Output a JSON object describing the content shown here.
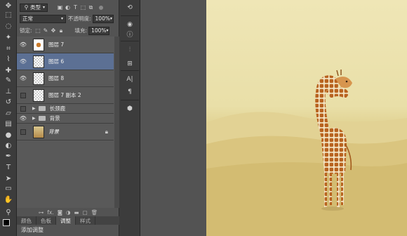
{
  "toolbar": {
    "tools": [
      {
        "icon": "move-icon",
        "glyph": "✥"
      },
      {
        "icon": "marquee-icon",
        "glyph": "⬚"
      },
      {
        "icon": "lasso-icon",
        "glyph": "◌"
      },
      {
        "icon": "magic-wand-icon",
        "glyph": "✦"
      },
      {
        "icon": "crop-icon",
        "glyph": "⌗"
      },
      {
        "icon": "eyedropper-icon",
        "glyph": "⌇"
      },
      {
        "icon": "healing-brush-icon",
        "glyph": "✚"
      },
      {
        "icon": "brush-icon",
        "glyph": "✎"
      },
      {
        "icon": "clone-stamp-icon",
        "glyph": "⊥"
      },
      {
        "icon": "history-brush-icon",
        "glyph": "↺"
      },
      {
        "icon": "eraser-icon",
        "glyph": "▱"
      },
      {
        "icon": "gradient-icon",
        "glyph": "▤"
      },
      {
        "icon": "blur-icon",
        "glyph": "●"
      },
      {
        "icon": "dodge-icon",
        "glyph": "◐"
      },
      {
        "icon": "pen-icon",
        "glyph": "✒"
      },
      {
        "icon": "type-icon",
        "glyph": "T"
      },
      {
        "icon": "path-selection-icon",
        "glyph": "➤"
      },
      {
        "icon": "rectangle-icon",
        "glyph": "▭"
      },
      {
        "icon": "hand-icon",
        "glyph": "✋"
      },
      {
        "icon": "zoom-icon",
        "glyph": "⚲"
      }
    ]
  },
  "layers_panel": {
    "filter_kind": "类型",
    "blend_mode": "正常",
    "opacity_label": "不透明度:",
    "opacity_value": "100%",
    "lock_label": "锁定:",
    "fill_label": "填充:",
    "fill_value": "100%",
    "layers": [
      {
        "name": "图层 7",
        "visible": true,
        "selected": false,
        "thumb": "giraffe",
        "type": "layer"
      },
      {
        "name": "图层 6",
        "visible": true,
        "selected": true,
        "thumb": "transparent",
        "type": "layer"
      },
      {
        "name": "图层 8",
        "visible": true,
        "selected": false,
        "thumb": "transparent",
        "type": "layer"
      },
      {
        "name": "图层 7 副本 2",
        "visible": false,
        "selected": false,
        "thumb": "transparent",
        "type": "layer"
      },
      {
        "name": "长颈鹿",
        "visible": false,
        "selected": false,
        "type": "group"
      },
      {
        "name": "背景",
        "visible": true,
        "selected": false,
        "type": "group"
      },
      {
        "name": "背景",
        "visible": false,
        "selected": false,
        "thumb": "bg",
        "type": "background",
        "locked": true
      }
    ],
    "bottom_icons": [
      "link-icon",
      "fx-icon",
      "mask-icon",
      "adjustment-icon",
      "folder-icon",
      "new-layer-icon",
      "trash-icon"
    ],
    "fx_text": "fx."
  },
  "bottom_tabs": {
    "tabs": [
      "颜色",
      "色板",
      "调整",
      "样式"
    ],
    "active": "调整",
    "adjust_label": "添加调整"
  },
  "dock": {
    "icons": [
      "history-icon",
      "color-wheel-icon",
      "info-icon",
      "adjust-sliders-icon",
      "properties-icon",
      "character-icon",
      "paragraph-icon",
      "3d-cube-icon"
    ]
  },
  "colors": {
    "panel_bg": "#535353",
    "selected_layer": "#5c7094",
    "canvas_sky": "#efe6b6",
    "canvas_sand": "#d9c57c",
    "giraffe": "#c97a2b"
  }
}
